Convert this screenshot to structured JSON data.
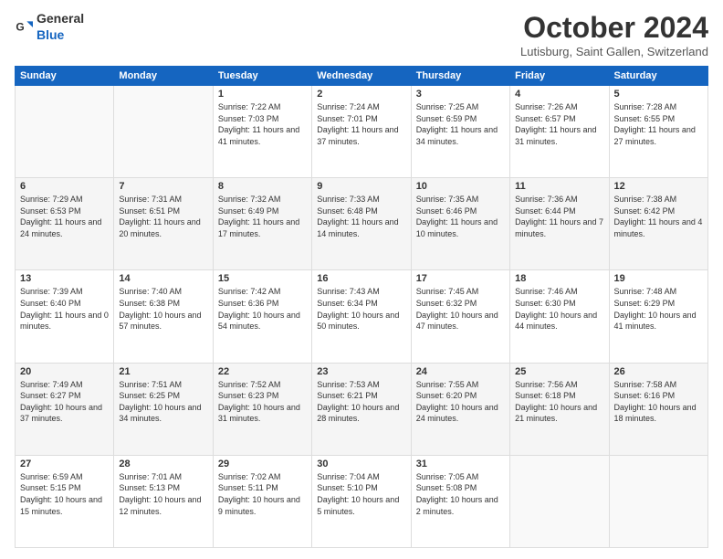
{
  "header": {
    "logo_general": "General",
    "logo_blue": "Blue",
    "month_title": "October 2024",
    "location": "Lutisburg, Saint Gallen, Switzerland"
  },
  "days_of_week": [
    "Sunday",
    "Monday",
    "Tuesday",
    "Wednesday",
    "Thursday",
    "Friday",
    "Saturday"
  ],
  "weeks": [
    [
      {
        "day": "",
        "sunrise": "",
        "sunset": "",
        "daylight": ""
      },
      {
        "day": "",
        "sunrise": "",
        "sunset": "",
        "daylight": ""
      },
      {
        "day": "1",
        "sunrise": "Sunrise: 7:22 AM",
        "sunset": "Sunset: 7:03 PM",
        "daylight": "Daylight: 11 hours and 41 minutes."
      },
      {
        "day": "2",
        "sunrise": "Sunrise: 7:24 AM",
        "sunset": "Sunset: 7:01 PM",
        "daylight": "Daylight: 11 hours and 37 minutes."
      },
      {
        "day": "3",
        "sunrise": "Sunrise: 7:25 AM",
        "sunset": "Sunset: 6:59 PM",
        "daylight": "Daylight: 11 hours and 34 minutes."
      },
      {
        "day": "4",
        "sunrise": "Sunrise: 7:26 AM",
        "sunset": "Sunset: 6:57 PM",
        "daylight": "Daylight: 11 hours and 31 minutes."
      },
      {
        "day": "5",
        "sunrise": "Sunrise: 7:28 AM",
        "sunset": "Sunset: 6:55 PM",
        "daylight": "Daylight: 11 hours and 27 minutes."
      }
    ],
    [
      {
        "day": "6",
        "sunrise": "Sunrise: 7:29 AM",
        "sunset": "Sunset: 6:53 PM",
        "daylight": "Daylight: 11 hours and 24 minutes."
      },
      {
        "day": "7",
        "sunrise": "Sunrise: 7:31 AM",
        "sunset": "Sunset: 6:51 PM",
        "daylight": "Daylight: 11 hours and 20 minutes."
      },
      {
        "day": "8",
        "sunrise": "Sunrise: 7:32 AM",
        "sunset": "Sunset: 6:49 PM",
        "daylight": "Daylight: 11 hours and 17 minutes."
      },
      {
        "day": "9",
        "sunrise": "Sunrise: 7:33 AM",
        "sunset": "Sunset: 6:48 PM",
        "daylight": "Daylight: 11 hours and 14 minutes."
      },
      {
        "day": "10",
        "sunrise": "Sunrise: 7:35 AM",
        "sunset": "Sunset: 6:46 PM",
        "daylight": "Daylight: 11 hours and 10 minutes."
      },
      {
        "day": "11",
        "sunrise": "Sunrise: 7:36 AM",
        "sunset": "Sunset: 6:44 PM",
        "daylight": "Daylight: 11 hours and 7 minutes."
      },
      {
        "day": "12",
        "sunrise": "Sunrise: 7:38 AM",
        "sunset": "Sunset: 6:42 PM",
        "daylight": "Daylight: 11 hours and 4 minutes."
      }
    ],
    [
      {
        "day": "13",
        "sunrise": "Sunrise: 7:39 AM",
        "sunset": "Sunset: 6:40 PM",
        "daylight": "Daylight: 11 hours and 0 minutes."
      },
      {
        "day": "14",
        "sunrise": "Sunrise: 7:40 AM",
        "sunset": "Sunset: 6:38 PM",
        "daylight": "Daylight: 10 hours and 57 minutes."
      },
      {
        "day": "15",
        "sunrise": "Sunrise: 7:42 AM",
        "sunset": "Sunset: 6:36 PM",
        "daylight": "Daylight: 10 hours and 54 minutes."
      },
      {
        "day": "16",
        "sunrise": "Sunrise: 7:43 AM",
        "sunset": "Sunset: 6:34 PM",
        "daylight": "Daylight: 10 hours and 50 minutes."
      },
      {
        "day": "17",
        "sunrise": "Sunrise: 7:45 AM",
        "sunset": "Sunset: 6:32 PM",
        "daylight": "Daylight: 10 hours and 47 minutes."
      },
      {
        "day": "18",
        "sunrise": "Sunrise: 7:46 AM",
        "sunset": "Sunset: 6:30 PM",
        "daylight": "Daylight: 10 hours and 44 minutes."
      },
      {
        "day": "19",
        "sunrise": "Sunrise: 7:48 AM",
        "sunset": "Sunset: 6:29 PM",
        "daylight": "Daylight: 10 hours and 41 minutes."
      }
    ],
    [
      {
        "day": "20",
        "sunrise": "Sunrise: 7:49 AM",
        "sunset": "Sunset: 6:27 PM",
        "daylight": "Daylight: 10 hours and 37 minutes."
      },
      {
        "day": "21",
        "sunrise": "Sunrise: 7:51 AM",
        "sunset": "Sunset: 6:25 PM",
        "daylight": "Daylight: 10 hours and 34 minutes."
      },
      {
        "day": "22",
        "sunrise": "Sunrise: 7:52 AM",
        "sunset": "Sunset: 6:23 PM",
        "daylight": "Daylight: 10 hours and 31 minutes."
      },
      {
        "day": "23",
        "sunrise": "Sunrise: 7:53 AM",
        "sunset": "Sunset: 6:21 PM",
        "daylight": "Daylight: 10 hours and 28 minutes."
      },
      {
        "day": "24",
        "sunrise": "Sunrise: 7:55 AM",
        "sunset": "Sunset: 6:20 PM",
        "daylight": "Daylight: 10 hours and 24 minutes."
      },
      {
        "day": "25",
        "sunrise": "Sunrise: 7:56 AM",
        "sunset": "Sunset: 6:18 PM",
        "daylight": "Daylight: 10 hours and 21 minutes."
      },
      {
        "day": "26",
        "sunrise": "Sunrise: 7:58 AM",
        "sunset": "Sunset: 6:16 PM",
        "daylight": "Daylight: 10 hours and 18 minutes."
      }
    ],
    [
      {
        "day": "27",
        "sunrise": "Sunrise: 6:59 AM",
        "sunset": "Sunset: 5:15 PM",
        "daylight": "Daylight: 10 hours and 15 minutes."
      },
      {
        "day": "28",
        "sunrise": "Sunrise: 7:01 AM",
        "sunset": "Sunset: 5:13 PM",
        "daylight": "Daylight: 10 hours and 12 minutes."
      },
      {
        "day": "29",
        "sunrise": "Sunrise: 7:02 AM",
        "sunset": "Sunset: 5:11 PM",
        "daylight": "Daylight: 10 hours and 9 minutes."
      },
      {
        "day": "30",
        "sunrise": "Sunrise: 7:04 AM",
        "sunset": "Sunset: 5:10 PM",
        "daylight": "Daylight: 10 hours and 5 minutes."
      },
      {
        "day": "31",
        "sunrise": "Sunrise: 7:05 AM",
        "sunset": "Sunset: 5:08 PM",
        "daylight": "Daylight: 10 hours and 2 minutes."
      },
      {
        "day": "",
        "sunrise": "",
        "sunset": "",
        "daylight": ""
      },
      {
        "day": "",
        "sunrise": "",
        "sunset": "",
        "daylight": ""
      }
    ]
  ]
}
